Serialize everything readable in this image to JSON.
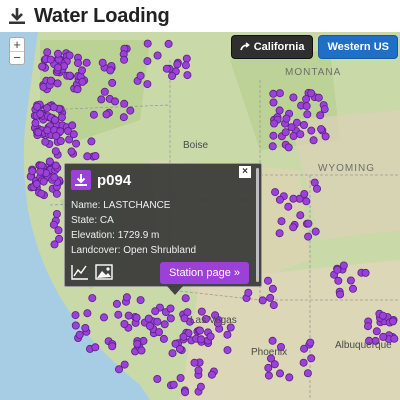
{
  "header": {
    "title": "Water Loading",
    "icon": "download-icon"
  },
  "region_buttons": [
    {
      "label": "California",
      "icon": "arrow-icon",
      "color": "#2f2f2f"
    },
    {
      "label": "Western US",
      "color": "#1f6fc6"
    }
  ],
  "zoom": {
    "in_label": "+",
    "out_label": "−"
  },
  "map": {
    "labels": {
      "montana": "MONTANA",
      "wyoming": "WYOMING"
    },
    "cities": {
      "boise": "Boise",
      "las_vegas": "Las Vegas",
      "albuquerque": "Albuquerque",
      "phoenix": "Phoenix"
    },
    "station_color": "#9b41d8"
  },
  "popup": {
    "station_id": "p094",
    "name_line": "Name: LASTCHANCE",
    "state_line": "State: CA",
    "elevation_line": "Elevation: 1729.9 m",
    "landcover_line": "Landcover: Open Shrubland",
    "station_button": "Station page »",
    "close_label": "×"
  }
}
